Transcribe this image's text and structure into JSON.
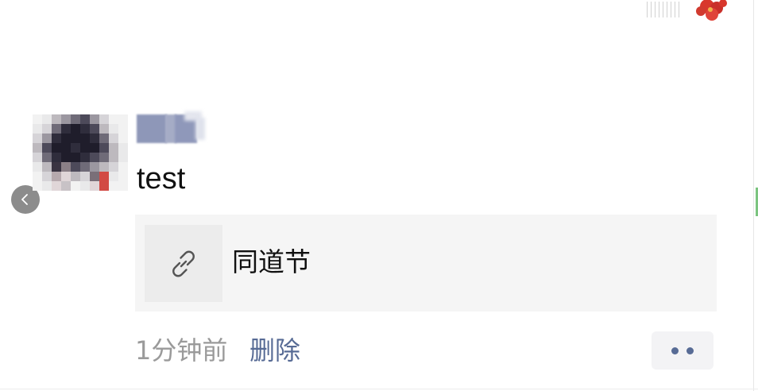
{
  "post": {
    "text": "test"
  },
  "link_card": {
    "title": "同道节",
    "icon": "link-icon"
  },
  "meta": {
    "timestamp": "1分钟前",
    "delete_label": "删除"
  },
  "controls": {
    "back_icon": "chevron-left-icon",
    "more_icon": "more-dots-icon"
  },
  "colors": {
    "link_blue": "#576b95",
    "timestamp_gray": "#9a9a9a",
    "card_background": "#f5f5f5"
  }
}
